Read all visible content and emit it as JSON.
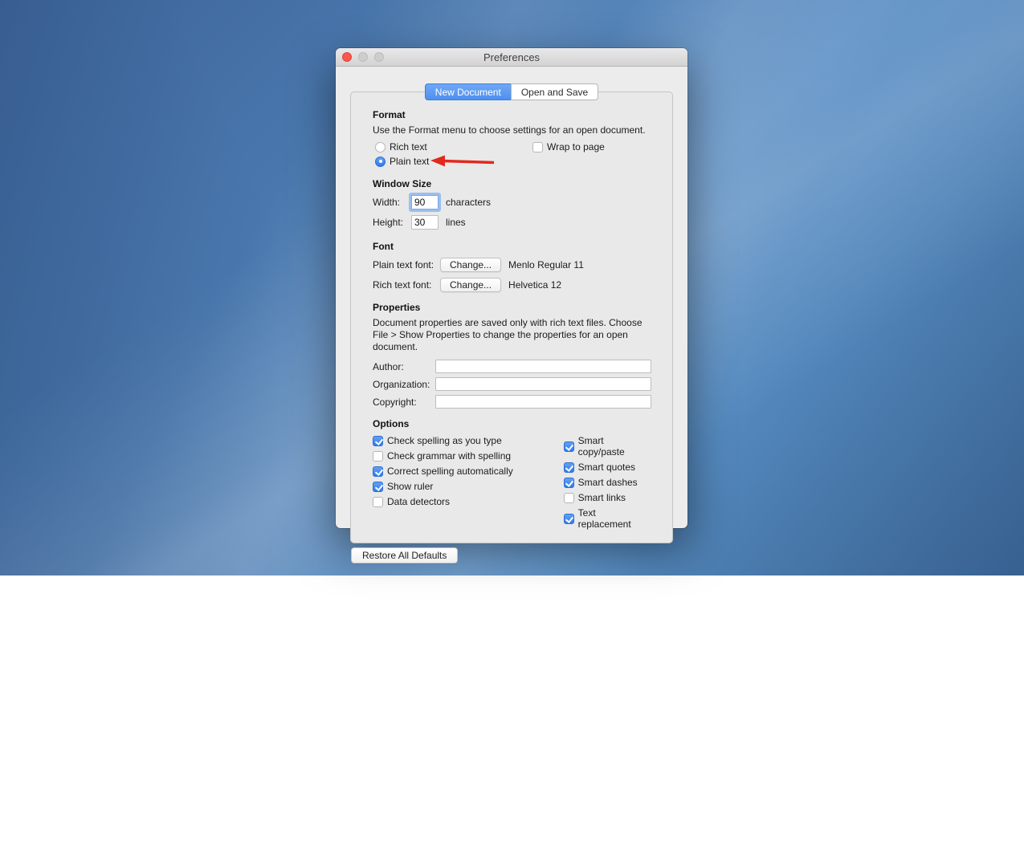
{
  "window": {
    "title": "Preferences",
    "tabs": [
      {
        "label": "New Document",
        "selected": true
      },
      {
        "label": "Open and Save",
        "selected": false
      }
    ]
  },
  "format": {
    "heading": "Format",
    "description": "Use the Format menu to choose settings for an open document.",
    "radios": [
      {
        "label": "Rich text",
        "selected": false
      },
      {
        "label": "Plain text",
        "selected": true
      }
    ],
    "wrap_checkbox": {
      "label": "Wrap to page",
      "checked": false
    }
  },
  "window_size": {
    "heading": "Window Size",
    "width_label": "Width:",
    "width_value": "90",
    "width_unit": "characters",
    "height_label": "Height:",
    "height_value": "30",
    "height_unit": "lines"
  },
  "font": {
    "heading": "Font",
    "plain_label": "Plain text font:",
    "rich_label": "Rich text font:",
    "change_button": "Change...",
    "plain_value": "Menlo Regular 11",
    "rich_value": "Helvetica 12"
  },
  "properties": {
    "heading": "Properties",
    "description": "Document properties are saved only with rich text files. Choose File > Show Properties to change the properties for an open document.",
    "author_label": "Author:",
    "organization_label": "Organization:",
    "copyright_label": "Copyright:",
    "author_value": "",
    "organization_value": "",
    "copyright_value": ""
  },
  "options": {
    "heading": "Options",
    "left": [
      {
        "label": "Check spelling as you type",
        "checked": true
      },
      {
        "label": "Check grammar with spelling",
        "checked": false
      },
      {
        "label": "Correct spelling automatically",
        "checked": true
      },
      {
        "label": "Show ruler",
        "checked": true
      },
      {
        "label": "Data detectors",
        "checked": false
      }
    ],
    "right": [
      {
        "label": "Smart copy/paste",
        "checked": true
      },
      {
        "label": "Smart quotes",
        "checked": true
      },
      {
        "label": "Smart dashes",
        "checked": true
      },
      {
        "label": "Smart links",
        "checked": false
      },
      {
        "label": "Text replacement",
        "checked": true
      }
    ]
  },
  "footer": {
    "restore_button": "Restore All Defaults"
  },
  "colors": {
    "accent_blue": "#4e8ff0",
    "annotation_red": "#e02a1e",
    "window_gray": "#ececec"
  }
}
